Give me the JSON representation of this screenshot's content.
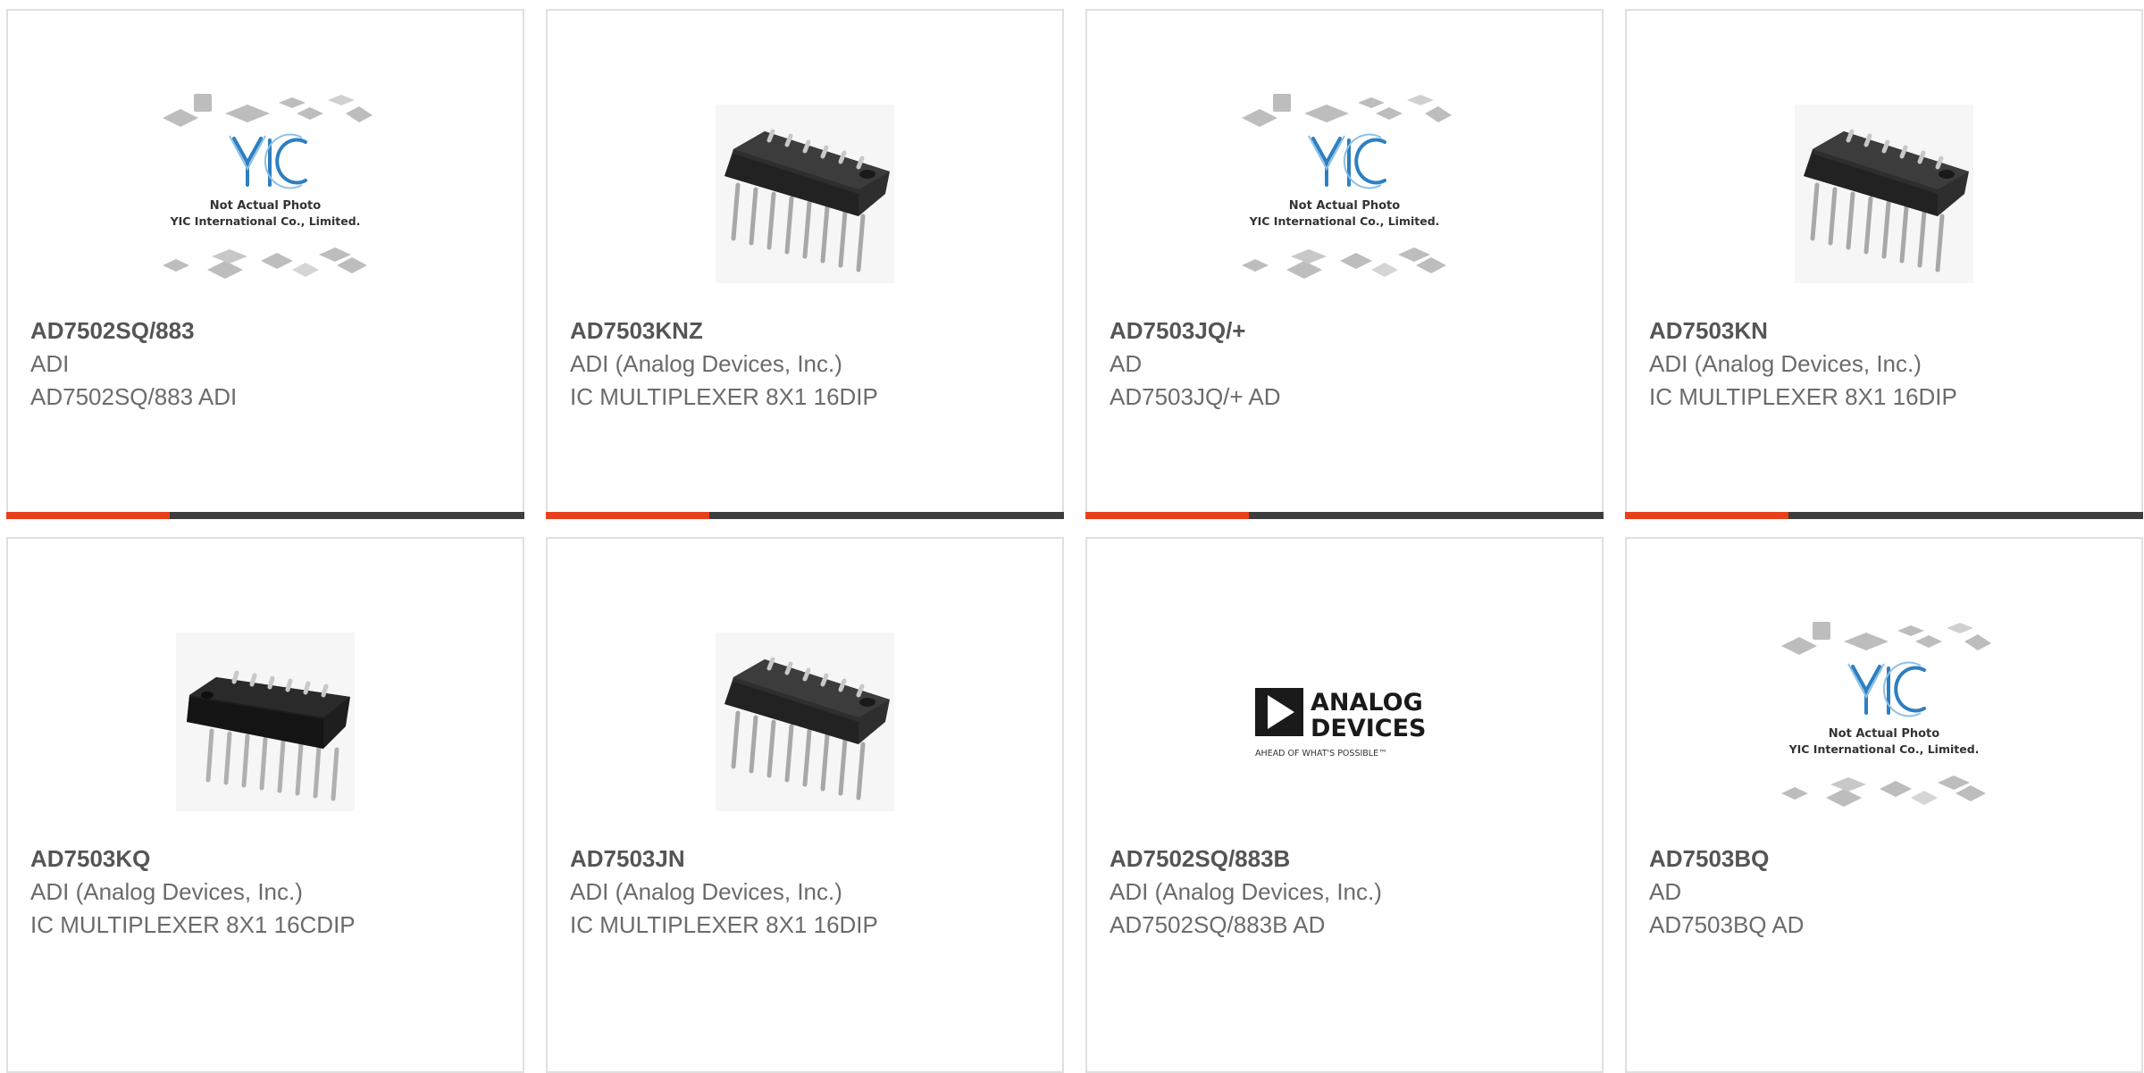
{
  "colors": {
    "accent": "#e8401c",
    "bar_dark": "#3d3d3d",
    "yic_blue": "#2d7fc1",
    "card_border": "#e0e0e0"
  },
  "products": [
    {
      "part_number": "AD7502SQ/883",
      "manufacturer": "ADI",
      "description": "AD7502SQ/883 ADI",
      "image": "yic-placeholder-icon",
      "caption_line1": "Not Actual Photo",
      "caption_line2": "YIC International Co., Limited.",
      "logo_text": "YIC"
    },
    {
      "part_number": "AD7503KNZ",
      "manufacturer": "ADI (Analog Devices, Inc.)",
      "description": "IC MULTIPLEXER 8X1 16DIP",
      "image": "dip16-chip-icon"
    },
    {
      "part_number": "AD7503JQ/+",
      "manufacturer": "AD",
      "description": "AD7503JQ/+ AD",
      "image": "yic-placeholder-icon",
      "caption_line1": "Not Actual Photo",
      "caption_line2": "YIC International Co., Limited.",
      "logo_text": "YIC"
    },
    {
      "part_number": "AD7503KN",
      "manufacturer": "ADI (Analog Devices, Inc.)",
      "description": "IC MULTIPLEXER 8X1 16DIP",
      "image": "dip16-chip-icon"
    },
    {
      "part_number": "AD7503KQ",
      "manufacturer": "ADI (Analog Devices, Inc.)",
      "description": "IC MULTIPLEXER 8X1 16CDIP",
      "image": "cdip16-chip-icon"
    },
    {
      "part_number": "AD7503JN",
      "manufacturer": "ADI (Analog Devices, Inc.)",
      "description": "IC MULTIPLEXER 8X1 16DIP",
      "image": "dip16-chip-icon"
    },
    {
      "part_number": "AD7502SQ/883B",
      "manufacturer": "ADI (Analog Devices, Inc.)",
      "description": "AD7502SQ/883B AD",
      "image": "analog-devices-logo",
      "logo_line1": "ANALOG",
      "logo_line2": "DEVICES",
      "logo_tagline": "AHEAD OF WHAT'S POSSIBLE™"
    },
    {
      "part_number": "AD7503BQ",
      "manufacturer": "AD",
      "description": "AD7503BQ AD",
      "image": "yic-placeholder-icon",
      "caption_line1": "Not Actual Photo",
      "caption_line2": "YIC International Co., Limited.",
      "logo_text": "YIC"
    }
  ]
}
